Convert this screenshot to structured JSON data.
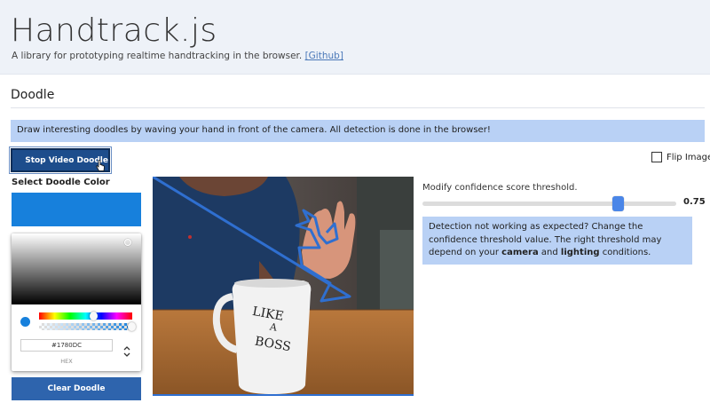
{
  "header": {
    "title": "Handtrack.js",
    "subtitle": "A library for prototyping realtime handtracking in the browser.",
    "link_label": "[Github]"
  },
  "section": {
    "title": "Doodle"
  },
  "banner": {
    "text": "Draw interesting doodles by waving your hand in front of the camera. All detection is done in the browser!"
  },
  "controls": {
    "stop_label": "Stop Video Doodle",
    "flip_label": "Flip Image",
    "flip_checked": false,
    "color_label": "Select Doodle Color",
    "clear_label": "Clear Doodle"
  },
  "picker": {
    "selected_color": "#1780DC",
    "hex_value": "#1780DC",
    "hex_label": "HEX"
  },
  "video": {
    "mug_text": [
      "LIKE",
      "A",
      "BOSS"
    ],
    "doodle_color": "#2f6fd0"
  },
  "threshold": {
    "label": "Modify confidence score threshold.",
    "value": "0.75",
    "fraction": 0.75
  },
  "help": {
    "text_before": "Detection not working as expected? Change the confidence threshold value. The right threshold may depend on your ",
    "camera": "camera",
    "and": " and ",
    "lighting": "lighting",
    "text_after": " conditions."
  },
  "icons": {
    "stop": "stop-icon",
    "cursor": "hand-pointer-icon",
    "toggle": "chevron-up-down-icon"
  }
}
